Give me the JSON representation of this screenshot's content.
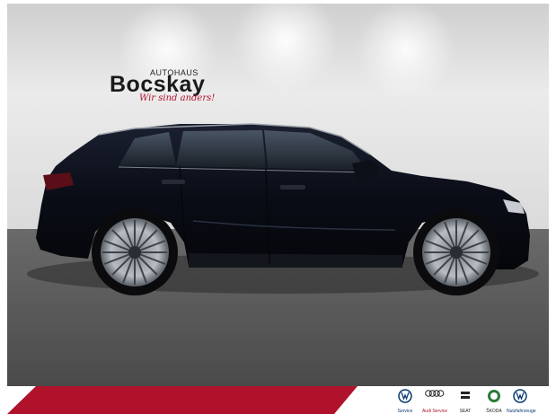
{
  "brand": {
    "top_line": "AUTOHAUS",
    "name": "Bocskay",
    "slogan": "Wir sind anders!"
  },
  "footer": {
    "logos": [
      {
        "icon": "vw-logo-icon",
        "label": "Service"
      },
      {
        "icon": "audi-rings-icon",
        "label": "Audi Service"
      },
      {
        "icon": "seat-logo-icon",
        "label": "SEAT"
      },
      {
        "icon": "skoda-logo-icon",
        "label": "ŠKODA"
      },
      {
        "icon": "vw-commercial-logo-icon",
        "label": "Nutzfahrzeuge"
      }
    ]
  },
  "colors": {
    "backdrop": "#e9e9e9",
    "floor": "#545454",
    "car_body": "#0a0d16",
    "accent_red": "#b0122c"
  }
}
